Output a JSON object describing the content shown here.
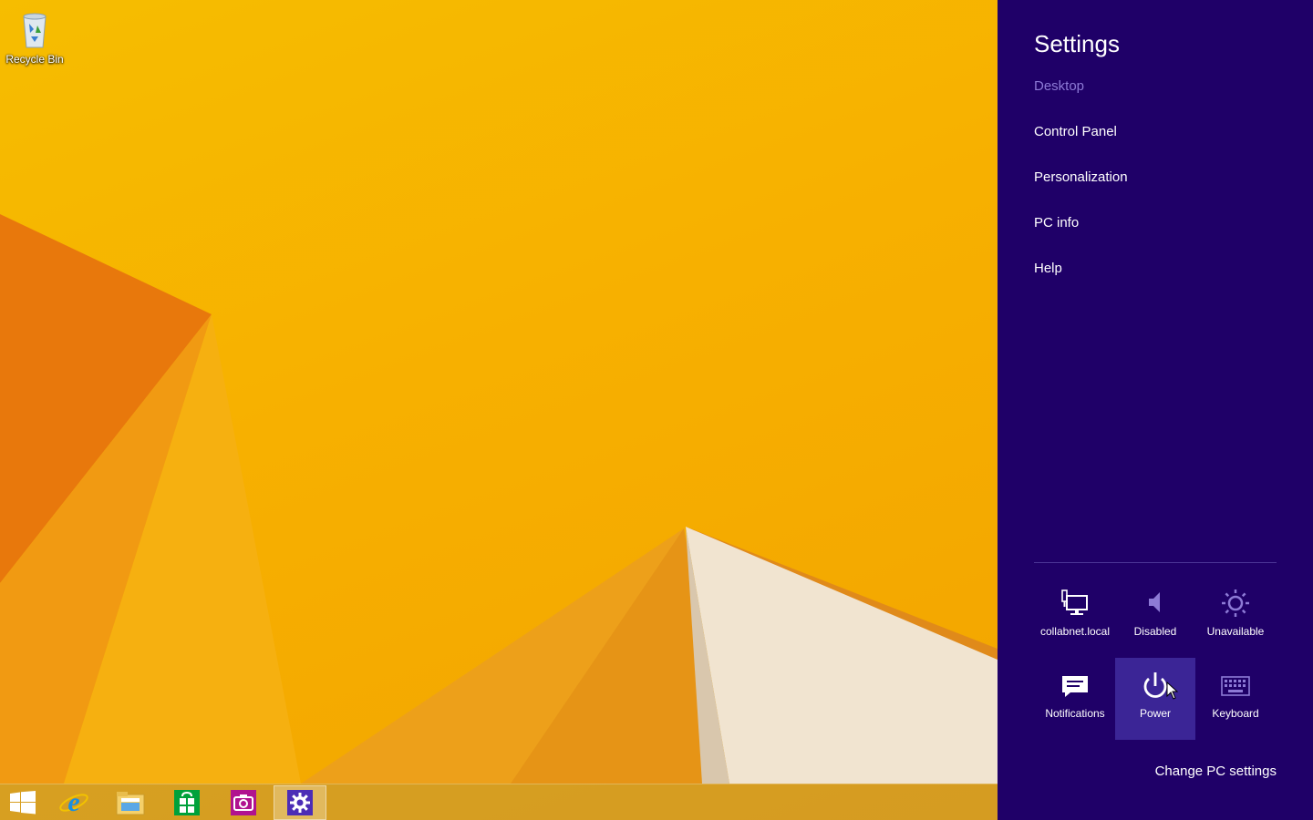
{
  "desktop": {
    "recycle_bin_label": "Recycle Bin",
    "wallpaper_colors": [
      "#f7b400",
      "#e8760a",
      "#f1e3cf"
    ]
  },
  "taskbar": {
    "items": [
      {
        "name": "start",
        "icon": "windows-logo-icon"
      },
      {
        "name": "internet-explorer",
        "icon": "internet-explorer-icon"
      },
      {
        "name": "file-explorer",
        "icon": "folder-icon"
      },
      {
        "name": "store",
        "icon": "store-icon"
      },
      {
        "name": "camera",
        "icon": "camera-icon"
      },
      {
        "name": "pc-settings",
        "icon": "gear-icon",
        "active": true
      }
    ]
  },
  "charm": {
    "title": "Settings",
    "subtitle": "Desktop",
    "links": [
      "Control Panel",
      "Personalization",
      "PC info",
      "Help"
    ],
    "tiles_row1": [
      {
        "label": "collabnet.local",
        "icon": "network-icon"
      },
      {
        "label": "Disabled",
        "icon": "volume-icon"
      },
      {
        "label": "Unavailable",
        "icon": "brightness-icon"
      }
    ],
    "tiles_row2": [
      {
        "label": "Notifications",
        "icon": "notifications-icon"
      },
      {
        "label": "Power",
        "icon": "power-icon",
        "highlighted": true
      },
      {
        "label": "Keyboard",
        "icon": "keyboard-icon"
      }
    ],
    "change_pc_settings": "Change PC settings",
    "colors": {
      "background": "#1f0068",
      "subtitle": "#8d7ad6",
      "tile_highlight": "#3b2596"
    }
  }
}
